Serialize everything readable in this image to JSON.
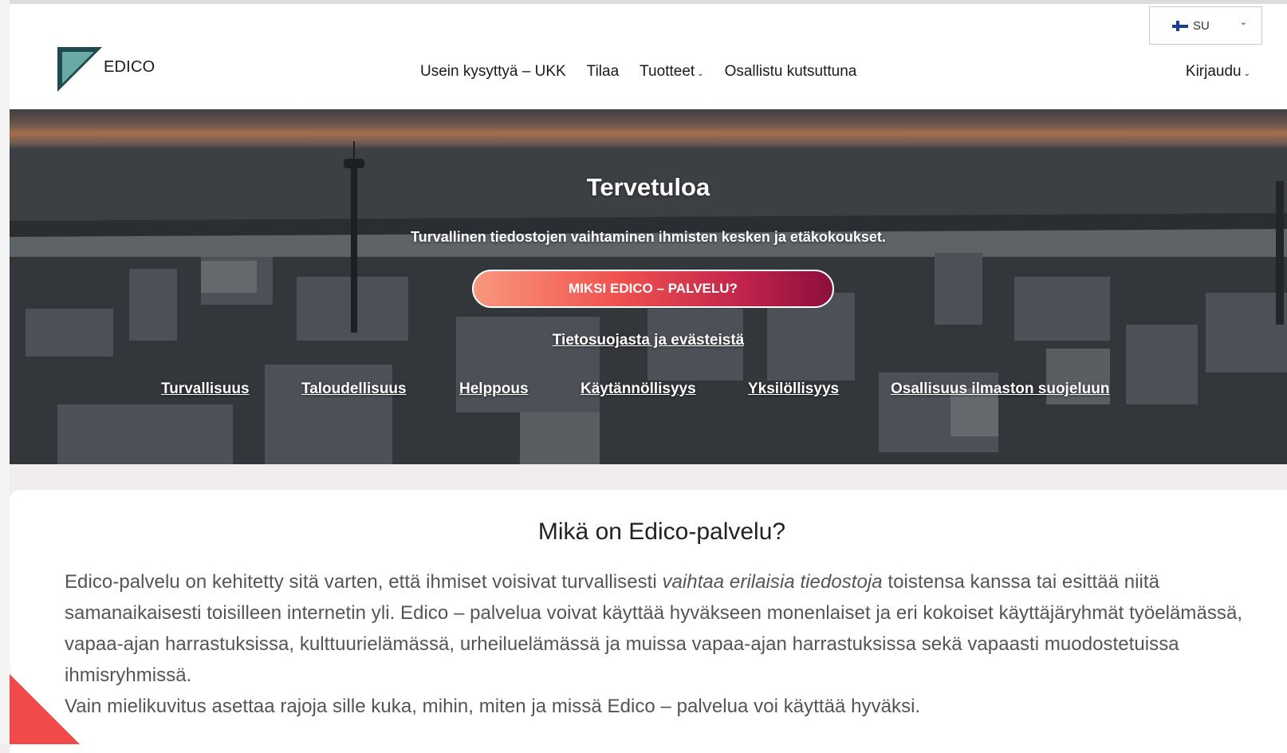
{
  "header": {
    "logo_text": "EDICO",
    "nav": [
      {
        "label": "Usein kysyttyä – UKK",
        "has_dropdown": false
      },
      {
        "label": "Tilaa",
        "has_dropdown": false
      },
      {
        "label": "Tuotteet",
        "has_dropdown": true
      },
      {
        "label": "Osallistu kutsuttuna",
        "has_dropdown": false
      }
    ],
    "login_label": "Kirjaudu",
    "language": {
      "code": "SU",
      "flag": "finland-flag-icon"
    }
  },
  "hero": {
    "title": "Tervetuloa",
    "subtitle": "Turvallinen tiedostojen vaihtaminen ihmisten kesken ja etäkokoukset.",
    "cta_label": "MIKSI EDICO – PALVELU?",
    "privacy_link": "Tietosuojasta ja evästeistä",
    "features": [
      "Turvallisuus",
      "Taloudellisuus",
      "Helppous",
      "Käytännöllisyys",
      "Yksilöllisyys",
      "Osallisuus ilmaston suojeluun"
    ]
  },
  "content": {
    "title": "Mikä on Edico-palvelu?",
    "paragraph1_before": "Edico-palvelu on kehitetty sitä varten, että ihmiset voisivat turvallisesti ",
    "paragraph1_italic": "vaihtaa erilaisia tiedostoja",
    "paragraph1_after": " toistensa kanssa tai esittää niitä samanaikaisesti toisilleen internetin yli. Edico – palvelua voivat käyttää hyväkseen monenlaiset ja eri kokoiset käyttäjäryhmät työelämässä, vapaa-ajan harrastuksissa, kulttuurielämässä, urheiluelämässä ja muissa vapaa-ajan harrastuksissa sekä vapaasti muodostetuissa ihmisryhmissä.",
    "paragraph2": "Vain mielikuvitus asettaa rajoja sille kuka, mihin, miten ja missä Edico – palvelua voi käyttää hyväksi."
  },
  "colors": {
    "cta_start": "#f9977e",
    "cta_end": "#8b0f3c",
    "logo_teal": "#6aaaa5",
    "logo_dark": "#1f4b4e",
    "corner_accent": "#f04a4a"
  }
}
